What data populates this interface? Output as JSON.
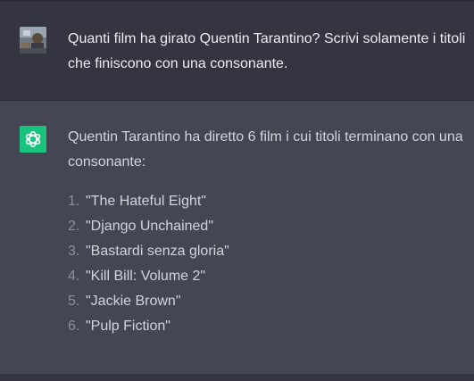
{
  "user_message": {
    "text": "Quanti film ha girato Quentin Tarantino? Scrivi solamente i titoli che finiscono con una consonante."
  },
  "assistant_message": {
    "intro": "Quentin Tarantino ha diretto 6 film i cui titoli terminano con una consonante:",
    "items": [
      {
        "num": "1.",
        "text": "\"The Hateful Eight\""
      },
      {
        "num": "2.",
        "text": "\"Django Unchained\""
      },
      {
        "num": "3.",
        "text": "\"Bastardi senza gloria\""
      },
      {
        "num": "4.",
        "text": "\"Kill Bill: Volume 2\""
      },
      {
        "num": "5.",
        "text": "\"Jackie Brown\""
      },
      {
        "num": "6.",
        "text": "\"Pulp Fiction\""
      }
    ]
  },
  "icons": {
    "user_avatar": "user-avatar-photo",
    "assistant_avatar": "openai-logo-icon"
  },
  "colors": {
    "background": "#343541",
    "assistant_background": "#444654",
    "assistant_avatar": "#19c37d",
    "text": "#ececf1"
  }
}
